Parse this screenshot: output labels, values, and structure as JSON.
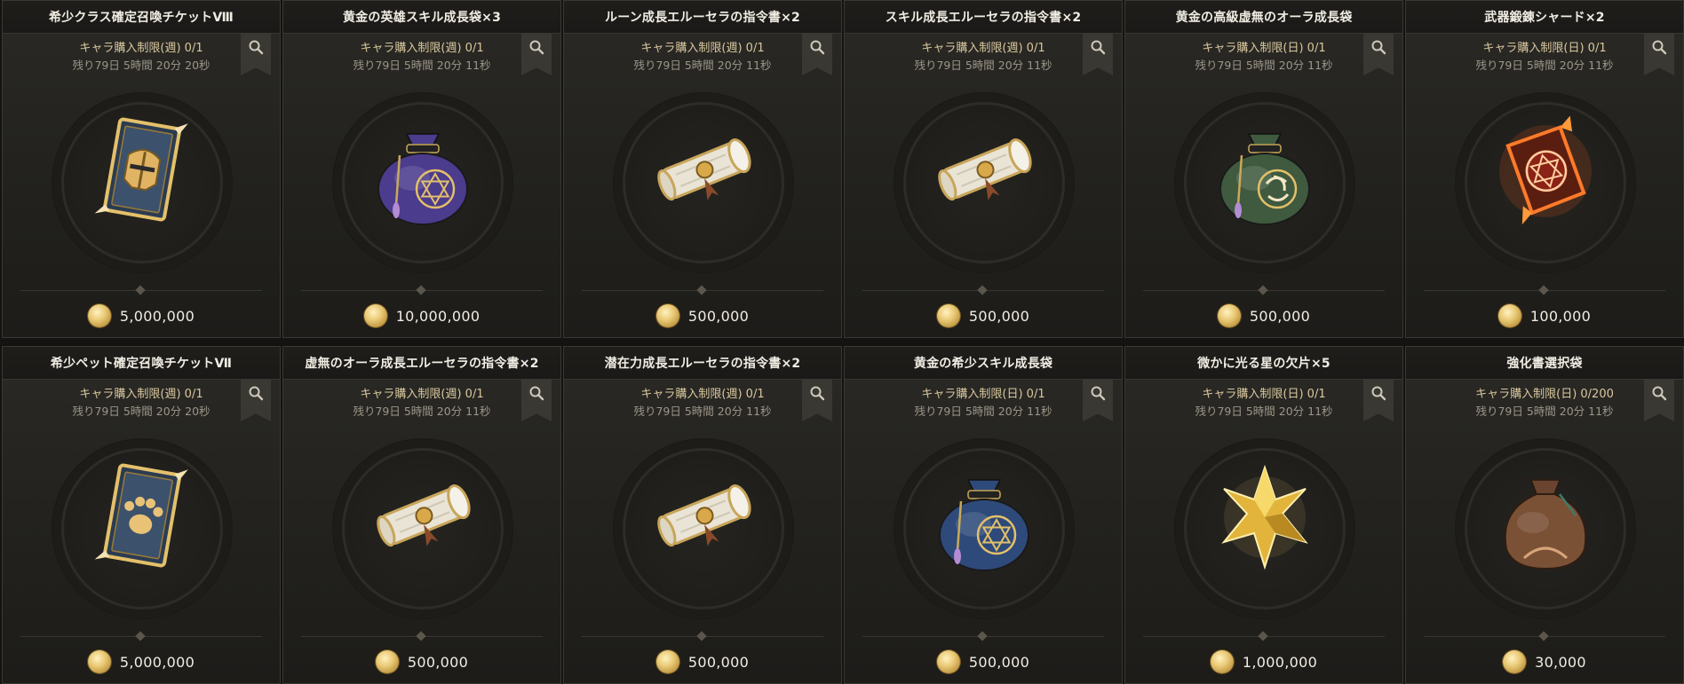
{
  "items": [
    {
      "name": "希少クラス確定召喚チケットⅧ",
      "limit": "キャラ購入制限(週) 0/1",
      "timer": "残り79日 5時間 20分 20秒",
      "price": "5,000,000",
      "icon": "class-summon-ticket-icon",
      "kind": "ticket",
      "emblem": "helmet"
    },
    {
      "name": "黄金の英雄スキル成長袋×3",
      "limit": "キャラ購入制限(週) 0/1",
      "timer": "残り79日 5時間 20分 11秒",
      "price": "10,000,000",
      "icon": "purple-pouch-icon",
      "kind": "pouch",
      "color": "#4b3c8e",
      "emblem": "hexagram"
    },
    {
      "name": "ルーン成長エルーセラの指令書×2",
      "limit": "キャラ購入制限(週) 0/1",
      "timer": "残り79日 5時間 20分 11秒",
      "price": "500,000",
      "icon": "scroll-icon",
      "kind": "scroll"
    },
    {
      "name": "スキル成長エルーセラの指令書×2",
      "limit": "キャラ購入制限(週) 0/1",
      "timer": "残り79日 5時間 20分 11秒",
      "price": "500,000",
      "icon": "scroll-icon",
      "kind": "scroll"
    },
    {
      "name": "黄金の高級虚無のオーラ成長袋",
      "limit": "キャラ購入制限(日) 0/1",
      "timer": "残り79日 5時間 20分 11秒",
      "price": "500,000",
      "icon": "green-pouch-icon",
      "kind": "pouch",
      "color": "#3f5a3f",
      "emblem": "swirl"
    },
    {
      "name": "武器鍛錬シャード×2",
      "limit": "キャラ購入制限(日) 0/1",
      "timer": "残り79日 5時間 20分 11秒",
      "price": "100,000",
      "icon": "weapon-shard-icon",
      "kind": "shard"
    },
    {
      "name": "希少ペット確定召喚チケットⅦ",
      "limit": "キャラ購入制限(週) 0/1",
      "timer": "残り79日 5時間 20分 20秒",
      "price": "5,000,000",
      "icon": "pet-summon-ticket-icon",
      "kind": "ticket",
      "emblem": "paw"
    },
    {
      "name": "虚無のオーラ成長エルーセラの指令書×2",
      "limit": "キャラ購入制限(週) 0/1",
      "timer": "残り79日 5時間 20分 11秒",
      "price": "500,000",
      "icon": "scroll-icon",
      "kind": "scroll"
    },
    {
      "name": "潜在力成長エルーセラの指令書×2",
      "limit": "キャラ購入制限(週) 0/1",
      "timer": "残り79日 5時間 20分 11秒",
      "price": "500,000",
      "icon": "scroll-icon",
      "kind": "scroll"
    },
    {
      "name": "黄金の希少スキル成長袋",
      "limit": "キャラ購入制限(日) 0/1",
      "timer": "残り79日 5時間 20分 11秒",
      "price": "500,000",
      "icon": "blue-pouch-icon",
      "kind": "pouch",
      "color": "#2e4a7a",
      "emblem": "hexagram"
    },
    {
      "name": "微かに光る星の欠片×5",
      "limit": "キャラ購入制限(日) 0/1",
      "timer": "残り79日 5時間 20分 11秒",
      "price": "1,000,000",
      "icon": "star-fragment-icon",
      "kind": "star"
    },
    {
      "name": "強化書選択袋",
      "limit": "キャラ購入制限(日) 0/200",
      "timer": "残り79日 5時間 20分 11秒",
      "price": "30,000",
      "icon": "brown-sack-icon",
      "kind": "sack"
    }
  ],
  "colors": {
    "title": "#f1ede4",
    "limit": "#d9c89f",
    "timer": "#9c968a",
    "price": "#f1ede4",
    "gold": "#e3c06a"
  }
}
